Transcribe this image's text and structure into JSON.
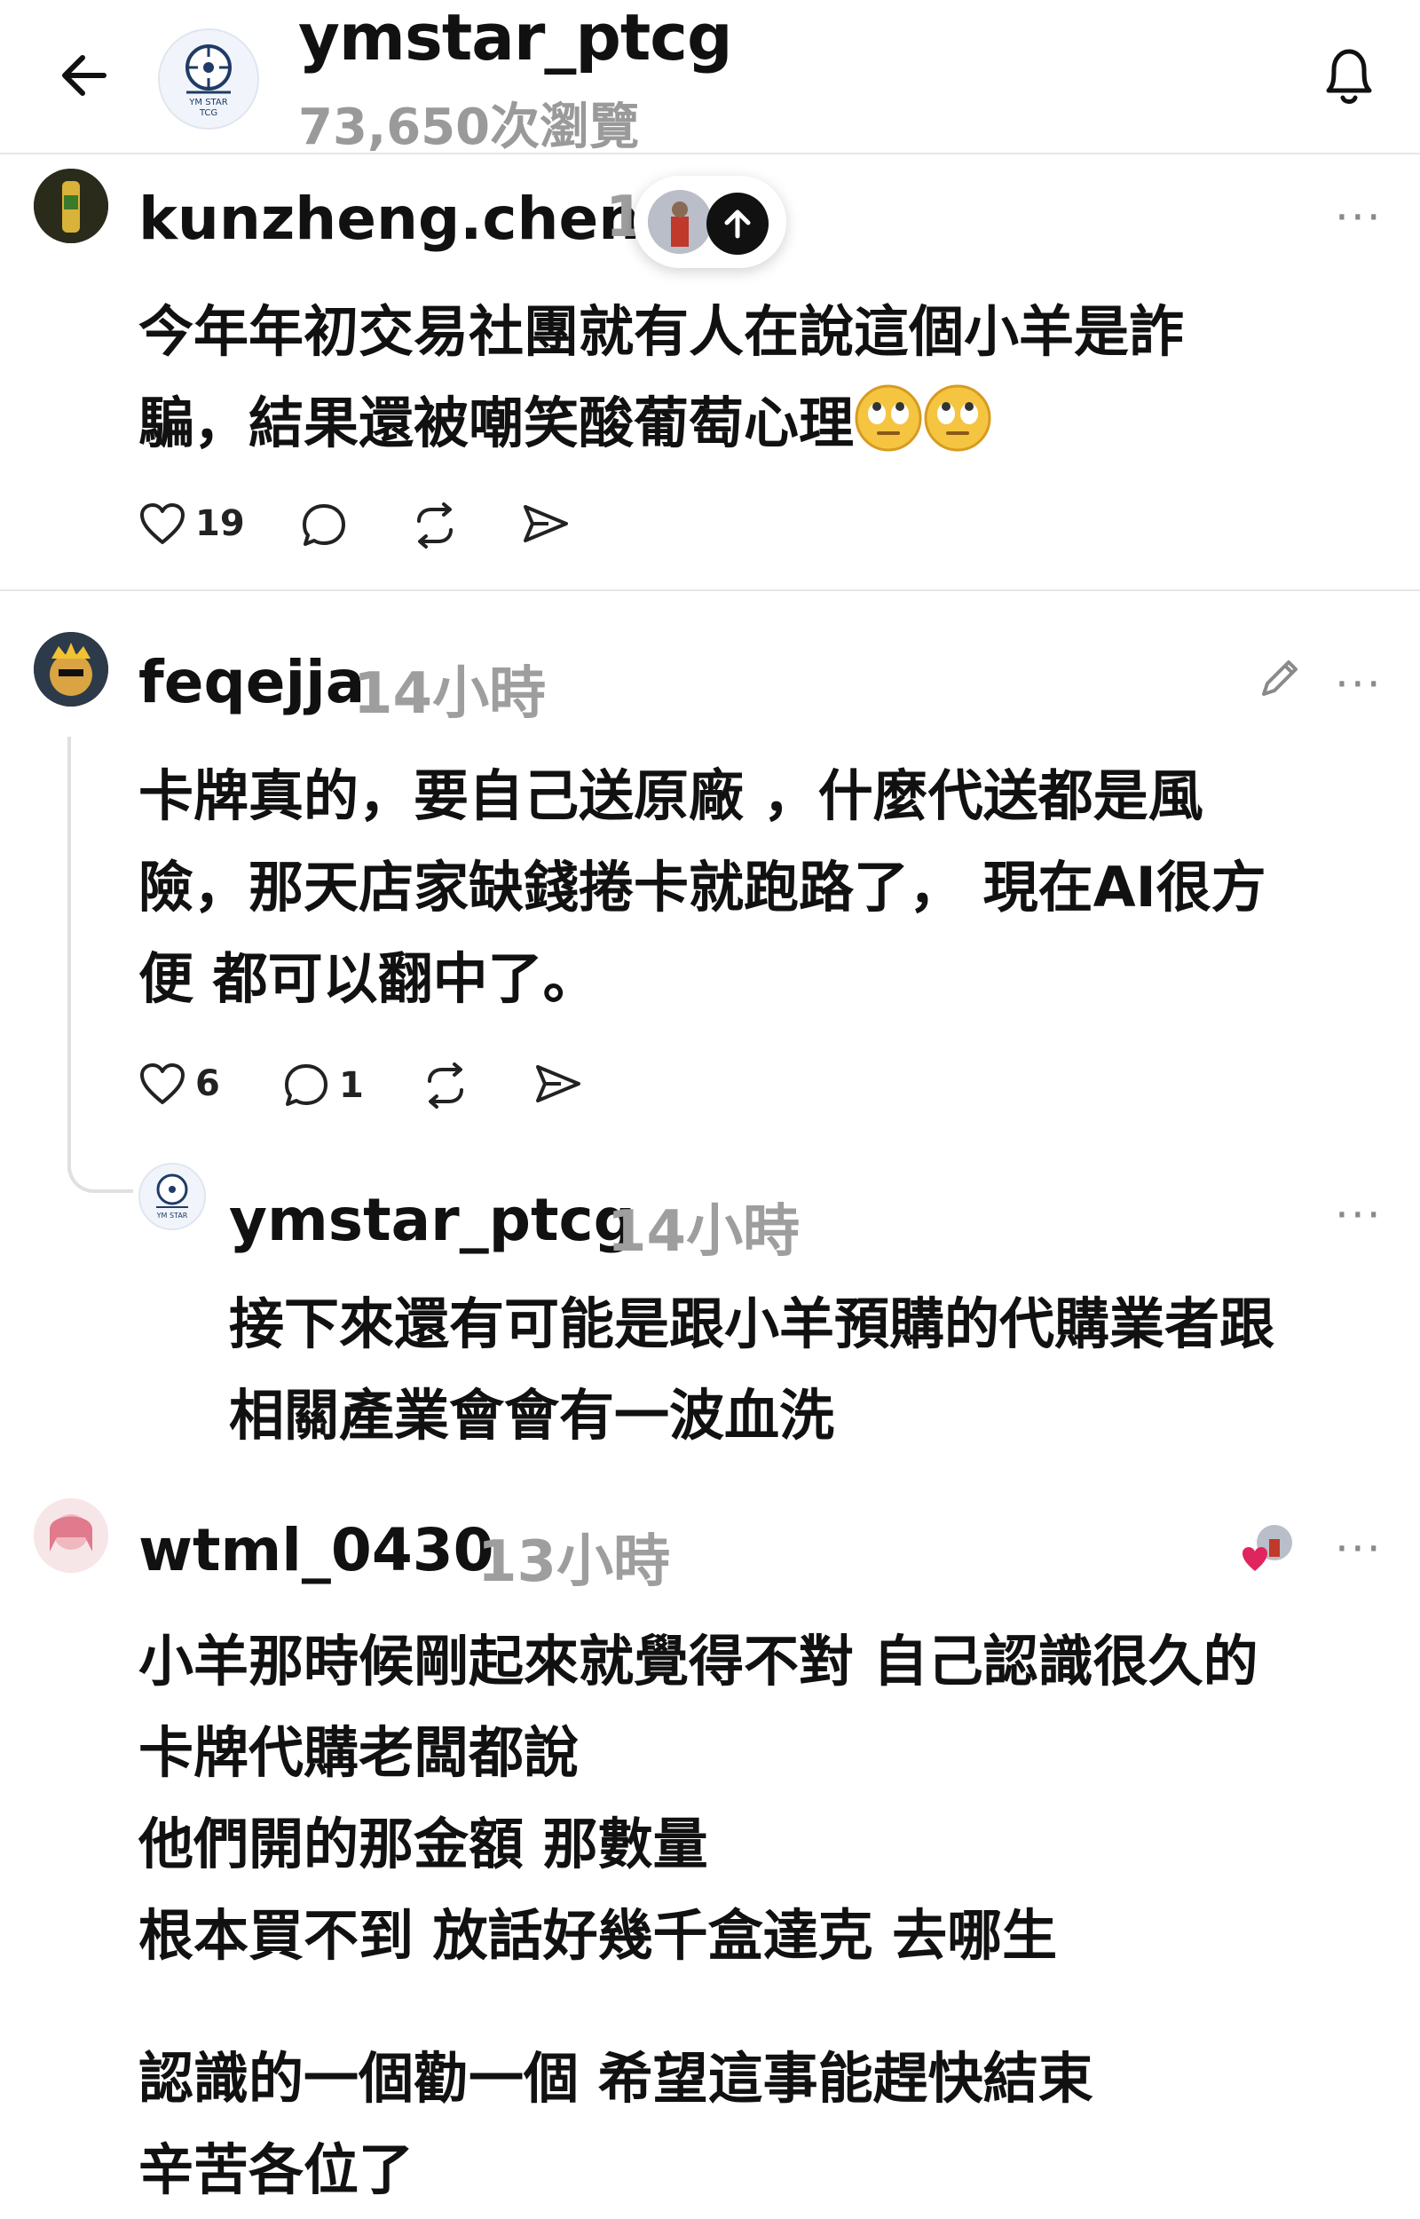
{
  "header": {
    "title": "ymstar_ptcg",
    "views": "73,650次瀏覽",
    "avatar_logo_text": "YM STAR TCG"
  },
  "scroll_top": {
    "icon": "arrow-up-icon"
  },
  "posts": [
    {
      "username": "kunzheng.chen",
      "time": "1",
      "lines": [
        "今年年初交易社團就有人在說這個小羊是詐",
        "騙，結果還被嘲笑酸葡萄心理"
      ],
      "emoji": [
        "eye-roll-emoji",
        "eye-roll-emoji"
      ],
      "likes": "19",
      "replies": "",
      "more": "···"
    },
    {
      "username": "feqejja",
      "time": "14小時",
      "lines": [
        "卡牌真的，要自己送原廠 ，什麼代送都是風",
        "險，那天店家缺錢捲卡就跑路了， 現在AI很方",
        "便 都可以翻中了。"
      ],
      "likes": "6",
      "replies": "1",
      "more": "···"
    },
    {
      "username": "ymstar_ptcg",
      "time": "14小時",
      "lines": [
        "接下來還有可能是跟小羊預購的代購業者跟",
        "相關產業會會有一波血洗"
      ],
      "more": "···"
    },
    {
      "username": "wtml_0430",
      "time": "13小時",
      "lines": [
        "小羊那時候剛起來就覺得不對 自己認識很久的",
        "卡牌代購老闆都說",
        "他們開的那金額 那數量",
        "根本買不到 放話好幾千盒達克 去哪生",
        "",
        "認識的一個勸一個 希望這事能趕快結束",
        "辛苦各位了"
      ],
      "more": "···"
    }
  ],
  "colors": {
    "like_heart": "#e0245e",
    "muted": "#9e9e9e",
    "divider": "#e6e6e6"
  }
}
